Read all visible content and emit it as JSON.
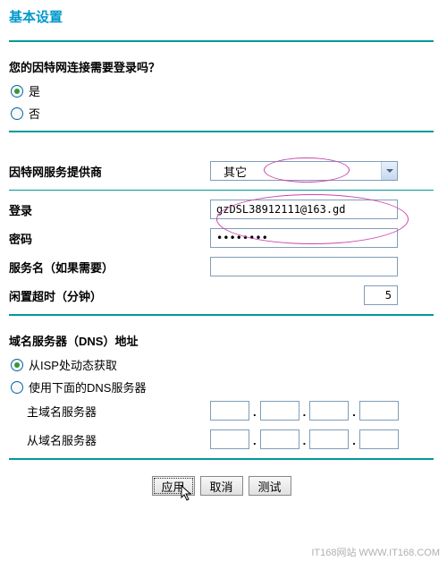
{
  "title": "基本设置",
  "login_question": "您的因特网连接需要登录吗？",
  "login_yes": "是",
  "login_no": "否",
  "isp_label": "因特网服务提供商",
  "isp_value": "其它",
  "fields": {
    "login_label": "登录",
    "login_value": "gzDSL38912111@163.gd",
    "password_label": "密码",
    "password_value": "••••••••",
    "service_label": "服务名（如果需要）",
    "service_value": "",
    "idle_label": "闲置超时（分钟）",
    "idle_value": "5"
  },
  "dns": {
    "header": "域名服务器（DNS）地址",
    "opt_auto": "从ISP处动态获取",
    "opt_manual": "使用下面的DNS服务器",
    "primary_label": "主域名服务器",
    "secondary_label": "从域名服务器"
  },
  "buttons": {
    "apply": "应用",
    "cancel": "取消",
    "test": "测试"
  },
  "footer": "IT168网站 WWW.IT168.COM"
}
